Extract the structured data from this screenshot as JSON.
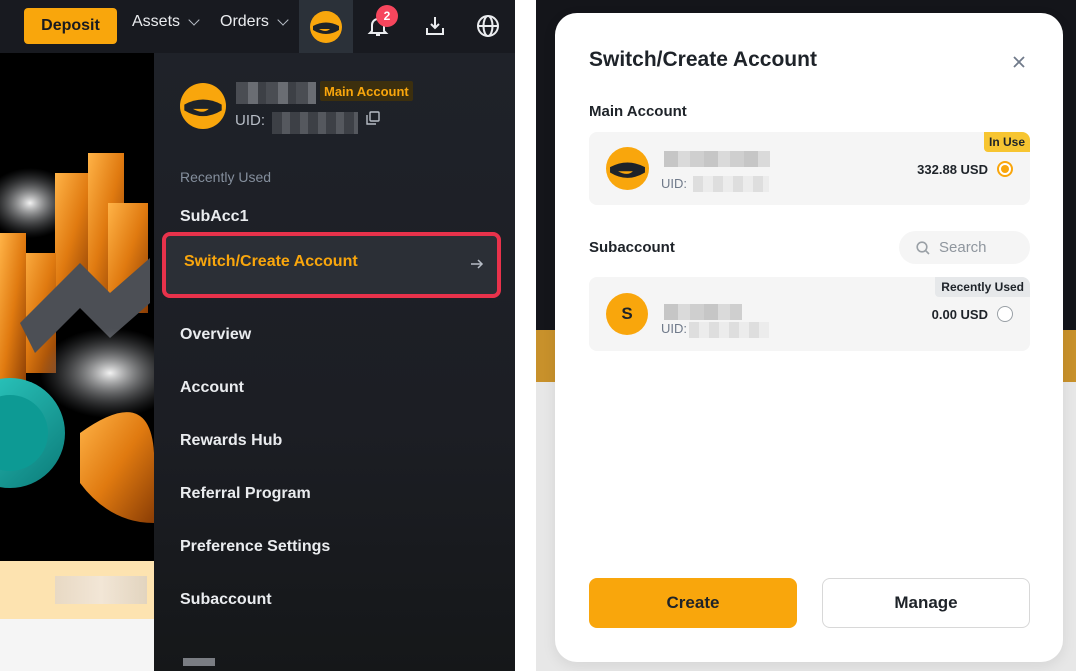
{
  "header": {
    "deposit_label": "Deposit",
    "assets_label": "Assets",
    "orders_label": "Orders",
    "notification_count": "2"
  },
  "dropdown": {
    "main_account_tag": "Main Account",
    "uid_prefix": "UID:",
    "recently_used_label": "Recently Used",
    "recent_item": "SubAcc1",
    "switch_create_label": "Switch/Create Account",
    "items": [
      "Overview",
      "Account",
      "Rewards Hub",
      "Referral Program",
      "Preference Settings",
      "Subaccount"
    ]
  },
  "modal": {
    "title": "Switch/Create Account",
    "main_section_title": "Main Account",
    "main_account": {
      "tag": "In Use",
      "uid_prefix": "UID:",
      "balance": "332.88 USD"
    },
    "subaccount_section_title": "Subaccount",
    "search_placeholder": "Search",
    "subaccount": {
      "avatar_letter": "S",
      "tag": "Recently Used",
      "uid_prefix": "UID:",
      "balance": "0.00 USD"
    },
    "create_label": "Create",
    "manage_label": "Manage"
  },
  "colors": {
    "accent": "#f9a60c",
    "highlight_border": "#e8324b",
    "dark_bg": "#1f2229"
  }
}
